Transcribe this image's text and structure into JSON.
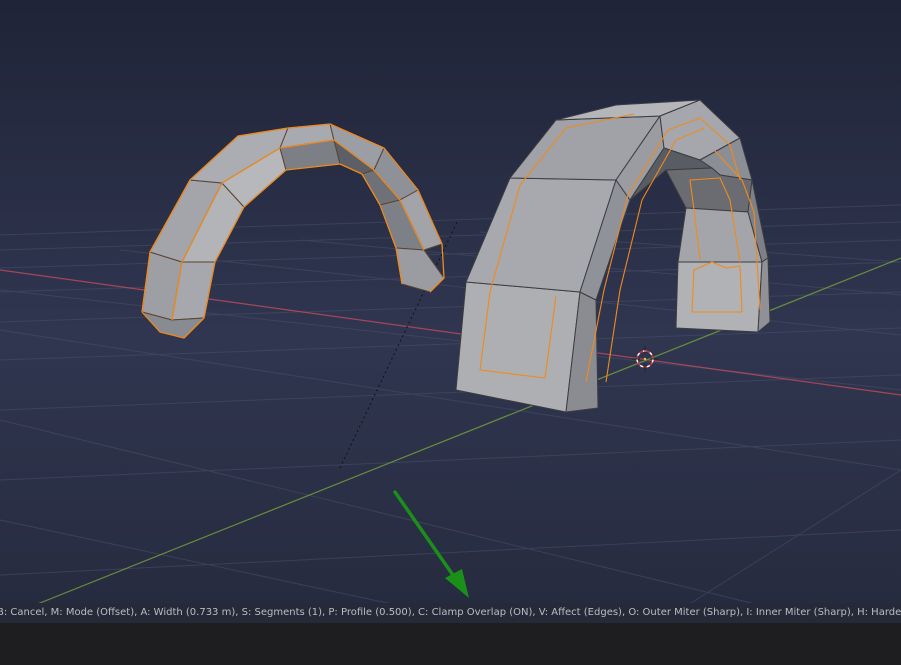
{
  "app": {
    "name": "Blender 3D Viewport - Bevel Operator"
  },
  "colors": {
    "background_top": "#21263a",
    "background_bottom": "#363d55",
    "grid": "#4a5068",
    "x_axis": "#b84b5b",
    "y_axis": "#6e9a3a",
    "mesh_face": "#a9abb0",
    "mesh_edge": "#3c3d40",
    "selected_edge": "#f08a1c",
    "arrow": "#1a8f1a",
    "status_text": "#b9bdc6"
  },
  "icons": {
    "cursor": "3d-cursor-icon",
    "pointer": "green-arrow-annotation"
  },
  "status_bar": {
    "text": "B: Cancel, M: Mode (Offset), A: Width (0.733 m), S: Segments (1), P: Profile (0.500), C: Clamp Overlap (ON), V: Affect (Edges), O: Outer Miter (Sharp), I: Inner Miter (Sharp), H: Harden Normals"
  }
}
